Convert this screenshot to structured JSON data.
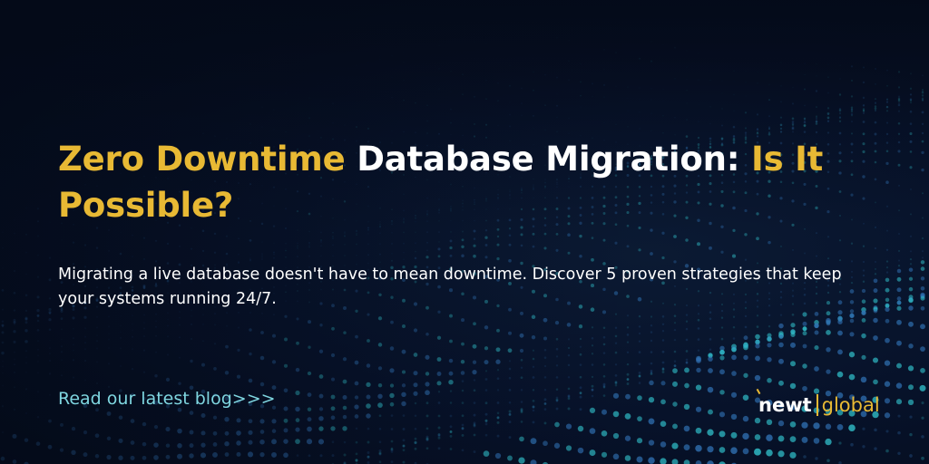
{
  "headline": {
    "part1": "Zero Downtime",
    "part2": "Database Migration:",
    "part3": "Is It Possible?"
  },
  "description": "Migrating a live database doesn't have to mean downtime. Discover 5 proven strategies that keep your systems running 24/7.",
  "cta_label": "Read our latest blog>>>",
  "logo": {
    "primary": "newt",
    "secondary": "global"
  },
  "colors": {
    "background": "#050c1c",
    "accent_yellow": "#e8b934",
    "cta_cyan": "#7fd6e0",
    "dot_cyan": "#2fb9c4",
    "dot_blue": "#2f6fb0",
    "text_white": "#ffffff"
  },
  "decoration": {
    "background_pattern": "dotted-wave-pattern"
  }
}
